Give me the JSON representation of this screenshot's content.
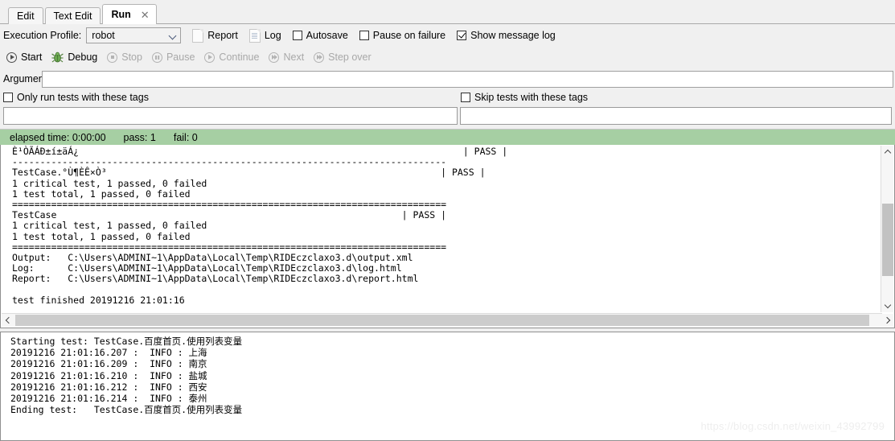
{
  "tabs": [
    {
      "label": "Edit",
      "active": false,
      "closable": false
    },
    {
      "label": "Text Edit",
      "active": false,
      "closable": false
    },
    {
      "label": "Run",
      "active": true,
      "closable": true,
      "close_glyph": "✕"
    }
  ],
  "toolbar": {
    "execution_profile_label": "Execution Profile:",
    "profile_value": "robot",
    "report_label": "Report",
    "log_label": "Log",
    "autosave_label": "Autosave",
    "autosave_checked": false,
    "pause_on_failure_label": "Pause on failure",
    "pause_on_failure_checked": false,
    "show_message_log_label": "Show message log",
    "show_message_log_checked": true
  },
  "runbar": {
    "start_label": "Start",
    "debug_label": "Debug",
    "stop_label": "Stop",
    "pause_label": "Pause",
    "continue_label": "Continue",
    "next_label": "Next",
    "step_over_label": "Step over"
  },
  "arguments": {
    "label": "Arguments:",
    "value": "",
    "placeholder": ""
  },
  "tags": {
    "only_run_label": "Only run tests with these tags",
    "only_run_checked": false,
    "only_run_value": "",
    "skip_label": "Skip tests with these tags",
    "skip_checked": false,
    "skip_value": ""
  },
  "status": {
    "elapsed": "elapsed time: 0:00:00",
    "pass": "pass: 1",
    "fail": "fail: 0"
  },
  "console": {
    "text": "È¹ÒÃÁÐ±í±äÁ¿                                                                     | PASS |\n------------------------------------------------------------------------------\nTestCase.°Ù¶ÈÊ×Ò³                                                            | PASS |\n1 critical test, 1 passed, 0 failed\n1 test total, 1 passed, 0 failed\n==============================================================================\nTestCase                                                              | PASS |\n1 critical test, 1 passed, 0 failed\n1 test total, 1 passed, 0 failed\n==============================================================================\nOutput:   C:\\Users\\ADMINI~1\\AppData\\Local\\Temp\\RIDEczclaxo3.d\\output.xml\nLog:      C:\\Users\\ADMINI~1\\AppData\\Local\\Temp\\RIDEczclaxo3.d\\log.html\nReport:   C:\\Users\\ADMINI~1\\AppData\\Local\\Temp\\RIDEczclaxo3.d\\report.html\n\ntest finished 20191216 21:01:16"
  },
  "message_log": {
    "text": "Starting test: TestCase.百度首页.使用列表变量\n20191216 21:01:16.207 :  INFO : 上海\n20191216 21:01:16.209 :  INFO : 南京\n20191216 21:01:16.210 :  INFO : 盐城\n20191216 21:01:16.212 :  INFO : 西安\n20191216 21:01:16.214 :  INFO : 泰州\nEnding test:   TestCase.百度首页.使用列表变量"
  },
  "watermark": {
    "text": "https://blog.csdn.net/weixin_43992799"
  },
  "colors": {
    "status_bar_green": "#a6cfa3",
    "window_bg": "#f0f0f0",
    "pane_bg": "#ffffff",
    "debug_bug_green": "#6aa84f"
  }
}
